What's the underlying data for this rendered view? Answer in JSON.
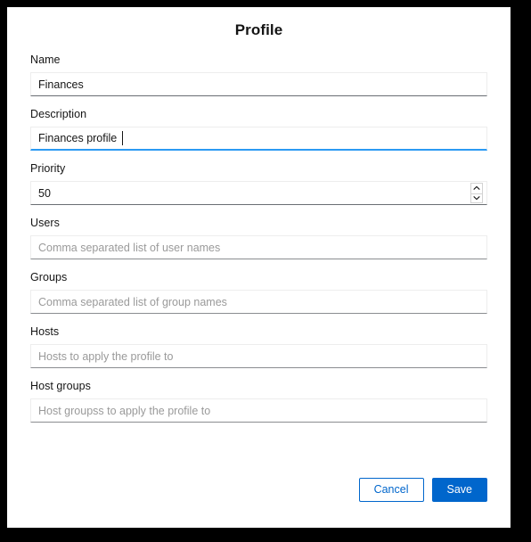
{
  "dialog": {
    "title": "Profile"
  },
  "fields": {
    "name": {
      "label": "Name",
      "value": "Finances",
      "placeholder": ""
    },
    "description": {
      "label": "Description",
      "value": "Finances profile",
      "placeholder": ""
    },
    "priority": {
      "label": "Priority",
      "value": "50",
      "placeholder": "",
      "spinner_up_icon": "chevron-up-icon",
      "spinner_down_icon": "chevron-down-icon"
    },
    "users": {
      "label": "Users",
      "value": "",
      "placeholder": "Comma separated list of user names"
    },
    "groups": {
      "label": "Groups",
      "value": "",
      "placeholder": "Comma separated list of group names"
    },
    "hosts": {
      "label": "Hosts",
      "value": "",
      "placeholder": "Hosts to apply the profile to"
    },
    "host_groups": {
      "label": "Host groups",
      "value": "",
      "placeholder": "Host groupss to apply the profile to"
    }
  },
  "footer": {
    "cancel_label": "Cancel",
    "save_label": "Save"
  },
  "colors": {
    "primary": "#0066cc",
    "link": "#0066cc",
    "focus_underline": "#2b9af3",
    "input_border": "#ededed",
    "input_border_bottom": "#8a8d90",
    "text": "#151515",
    "placeholder": "#9a9a9a",
    "frame": "#000000",
    "page_bg": "#ffffff"
  }
}
